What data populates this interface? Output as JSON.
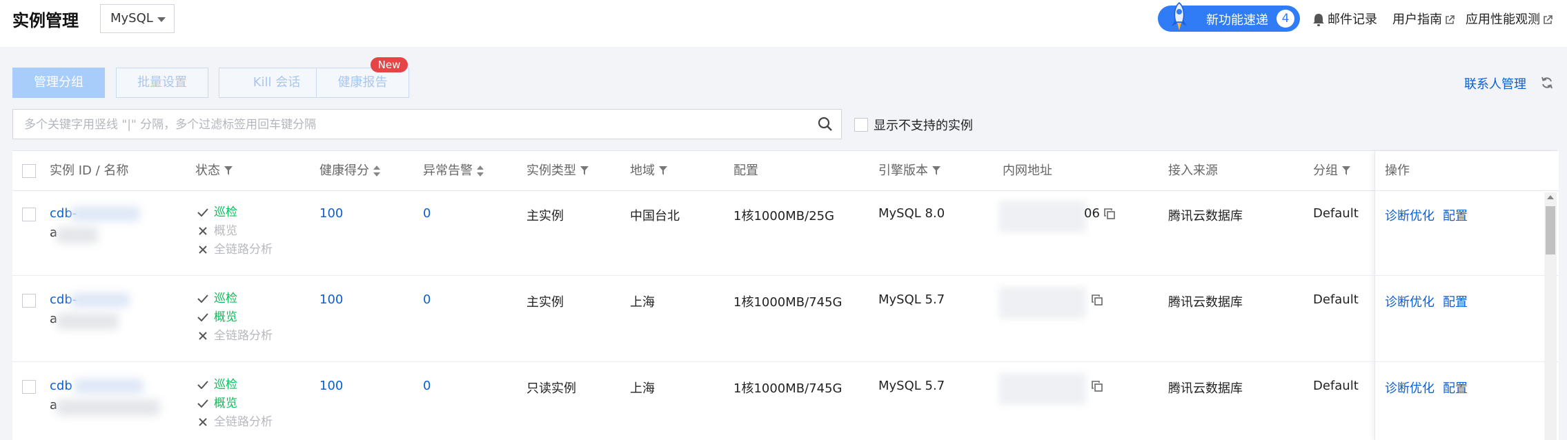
{
  "header": {
    "title": "实例管理",
    "db_type": "MySQL",
    "promo_label": "新功能速递",
    "promo_count": "4",
    "links": [
      "邮件记录",
      "用户指南",
      "应用性能观测"
    ]
  },
  "toolbar": {
    "group_btn": "管理分组",
    "batch_btn": "批量设置",
    "kill_btn": "Kill 会话",
    "health_btn": "健康报告",
    "new_badge": "New",
    "contact_link": "联系人管理"
  },
  "search": {
    "placeholder": "多个关键字用竖线 \"|\" 分隔，多个过滤标签用回车键分隔",
    "show_unsupported": "显示不支持的实例"
  },
  "table": {
    "columns": {
      "id": "实例 ID / 名称",
      "status": "状态",
      "health": "健康得分",
      "alarms": "异常告警",
      "type": "实例类型",
      "region": "地域",
      "config": "配置",
      "engine": "引擎版本",
      "ip": "内网地址",
      "source": "接入来源",
      "group": "分组",
      "ops": "操作"
    },
    "monitor_labels": [
      "巡检",
      "概览",
      "全链路分析"
    ],
    "ops": [
      "诊断优化",
      "配置"
    ],
    "rows": [
      {
        "id_prefix": "cdb-",
        "name_prefix": "a",
        "monitors": [
          true,
          false,
          false
        ],
        "health": "100",
        "alarms": "0",
        "type": "主实例",
        "region": "中国台北",
        "config": "1核1000MB/25G",
        "engine": "MySQL 8.0",
        "ip_suffix": "06",
        "source": "腾讯云数据库",
        "group": "Default"
      },
      {
        "id_prefix": "cdb-",
        "name_prefix": "a",
        "monitors": [
          true,
          true,
          false
        ],
        "health": "100",
        "alarms": "0",
        "type": "主实例",
        "region": "上海",
        "config": "1核1000MB/745G",
        "engine": "MySQL 5.7",
        "ip_suffix": "",
        "source": "腾讯云数据库",
        "group": "Default"
      },
      {
        "id_prefix": "cdb",
        "name_prefix": "a",
        "monitors": [
          true,
          true,
          false
        ],
        "health": "100",
        "alarms": "0",
        "type": "只读实例",
        "region": "上海",
        "config": "1核1000MB/745G",
        "engine": "MySQL 5.7",
        "ip_suffix": "",
        "source": "腾讯云数据库",
        "group": "Default"
      }
    ]
  },
  "colors": {
    "accent": "#0a5fd6",
    "success": "#0abf5b",
    "promo": "#2f7cf6",
    "badge": "#e54545"
  }
}
